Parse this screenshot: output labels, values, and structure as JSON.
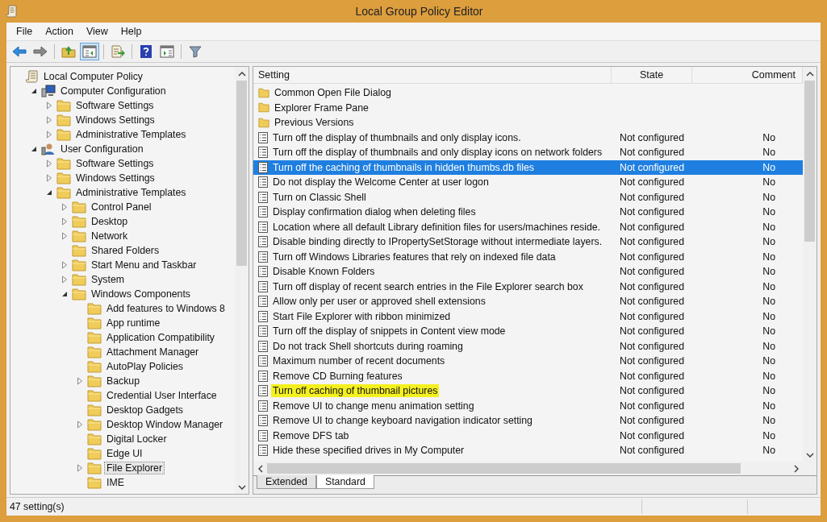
{
  "window": {
    "title": "Local Group Policy Editor"
  },
  "menu": [
    "File",
    "Action",
    "View",
    "Help"
  ],
  "toolbar": [
    {
      "kind": "back",
      "pressed": false
    },
    {
      "kind": "forward",
      "pressed": false
    },
    {
      "kind": "up",
      "pressed": false
    },
    {
      "kind": "tree",
      "pressed": true
    },
    {
      "kind": "export",
      "pressed": false
    },
    {
      "kind": "help",
      "pressed": false
    },
    {
      "kind": "pane",
      "pressed": false
    },
    {
      "kind": "filter",
      "pressed": false
    }
  ],
  "tree": [
    {
      "label": "Local Computer Policy",
      "kind": "policy",
      "selected": false,
      "children": [
        {
          "label": "Computer Configuration",
          "kind": "computer",
          "expanded": true,
          "selected": false,
          "children": [
            {
              "label": "Software Settings",
              "kind": "folder",
              "expanded": false,
              "selected": false
            },
            {
              "label": "Windows Settings",
              "kind": "folder",
              "expanded": false,
              "selected": false
            },
            {
              "label": "Administrative Templates",
              "kind": "folder",
              "expanded": false,
              "selected": false
            }
          ]
        },
        {
          "label": "User Configuration",
          "kind": "user",
          "expanded": true,
          "selected": false,
          "children": [
            {
              "label": "Software Settings",
              "kind": "folder",
              "expanded": false,
              "selected": false
            },
            {
              "label": "Windows Settings",
              "kind": "folder",
              "expanded": false,
              "selected": false
            },
            {
              "label": "Administrative Templates",
              "kind": "folder",
              "expanded": true,
              "selected": false,
              "children": [
                {
                  "label": "Control Panel",
                  "kind": "folder",
                  "expanded": false,
                  "selected": false
                },
                {
                  "label": "Desktop",
                  "kind": "folder",
                  "expanded": false,
                  "selected": false
                },
                {
                  "label": "Network",
                  "kind": "folder",
                  "expanded": false,
                  "selected": false
                },
                {
                  "label": "Shared Folders",
                  "kind": "folder",
                  "selected": false
                },
                {
                  "label": "Start Menu and Taskbar",
                  "kind": "folder",
                  "expanded": false,
                  "selected": false
                },
                {
                  "label": "System",
                  "kind": "folder",
                  "expanded": false,
                  "selected": false
                },
                {
                  "label": "Windows Components",
                  "kind": "folder",
                  "expanded": true,
                  "selected": false,
                  "children": [
                    {
                      "label": "Add features to Windows 8",
                      "kind": "folder",
                      "selected": false
                    },
                    {
                      "label": "App runtime",
                      "kind": "folder",
                      "selected": false
                    },
                    {
                      "label": "Application Compatibility",
                      "kind": "folder",
                      "selected": false
                    },
                    {
                      "label": "Attachment Manager",
                      "kind": "folder",
                      "selected": false
                    },
                    {
                      "label": "AutoPlay Policies",
                      "kind": "folder",
                      "selected": false
                    },
                    {
                      "label": "Backup",
                      "kind": "folder",
                      "expanded": false,
                      "selected": false
                    },
                    {
                      "label": "Credential User Interface",
                      "kind": "folder",
                      "selected": false
                    },
                    {
                      "label": "Desktop Gadgets",
                      "kind": "folder",
                      "selected": false
                    },
                    {
                      "label": "Desktop Window Manager",
                      "kind": "folder",
                      "expanded": false,
                      "selected": false
                    },
                    {
                      "label": "Digital Locker",
                      "kind": "folder",
                      "selected": false
                    },
                    {
                      "label": "Edge UI",
                      "kind": "folder",
                      "selected": false
                    },
                    {
                      "label": "File Explorer",
                      "kind": "folder",
                      "expanded": false,
                      "selected": true
                    },
                    {
                      "label": "IME",
                      "kind": "folder",
                      "selected": false
                    }
                  ]
                }
              ]
            }
          ]
        }
      ]
    }
  ],
  "table": {
    "columns": [
      "Setting",
      "State",
      "Comment"
    ],
    "rows": [
      {
        "kind": "folder",
        "setting": "Common Open File Dialog",
        "selected": false,
        "highlighted": false
      },
      {
        "kind": "folder",
        "setting": "Explorer Frame Pane",
        "selected": false,
        "highlighted": false
      },
      {
        "kind": "folder",
        "setting": "Previous Versions",
        "selected": false,
        "highlighted": false
      },
      {
        "kind": "setting",
        "setting": "Turn off the display of thumbnails and only display icons.",
        "state": "Not configured",
        "comment": "No",
        "selected": false,
        "highlighted": false
      },
      {
        "kind": "setting",
        "setting": "Turn off the display of thumbnails and only display icons on network folders",
        "state": "Not configured",
        "comment": "No",
        "selected": false,
        "highlighted": false
      },
      {
        "kind": "setting",
        "setting": "Turn off the caching of thumbnails in hidden thumbs.db files",
        "state": "Not configured",
        "comment": "No",
        "selected": true,
        "highlighted": false
      },
      {
        "kind": "setting",
        "setting": "Do not display the Welcome Center at user logon",
        "state": "Not configured",
        "comment": "No",
        "selected": false,
        "highlighted": false
      },
      {
        "kind": "setting",
        "setting": "Turn on Classic Shell",
        "state": "Not configured",
        "comment": "No",
        "selected": false,
        "highlighted": false
      },
      {
        "kind": "setting",
        "setting": "Display confirmation dialog when deleting files",
        "state": "Not configured",
        "comment": "No",
        "selected": false,
        "highlighted": false
      },
      {
        "kind": "setting",
        "setting": "Location where all default Library definition files for users/machines reside.",
        "state": "Not configured",
        "comment": "No",
        "selected": false,
        "highlighted": false
      },
      {
        "kind": "setting",
        "setting": "Disable binding directly to IPropertySetStorage without intermediate layers.",
        "state": "Not configured",
        "comment": "No",
        "selected": false,
        "highlighted": false
      },
      {
        "kind": "setting",
        "setting": "Turn off Windows Libraries features that rely on indexed file data",
        "state": "Not configured",
        "comment": "No",
        "selected": false,
        "highlighted": false
      },
      {
        "kind": "setting",
        "setting": "Disable Known Folders",
        "state": "Not configured",
        "comment": "No",
        "selected": false,
        "highlighted": false
      },
      {
        "kind": "setting",
        "setting": "Turn off display of recent search entries in the File Explorer search box",
        "state": "Not configured",
        "comment": "No",
        "selected": false,
        "highlighted": false
      },
      {
        "kind": "setting",
        "setting": "Allow only per user or approved shell extensions",
        "state": "Not configured",
        "comment": "No",
        "selected": false,
        "highlighted": false
      },
      {
        "kind": "setting",
        "setting": "Start File Explorer with ribbon minimized",
        "state": "Not configured",
        "comment": "No",
        "selected": false,
        "highlighted": false
      },
      {
        "kind": "setting",
        "setting": "Turn off the display of snippets in Content view mode",
        "state": "Not configured",
        "comment": "No",
        "selected": false,
        "highlighted": false
      },
      {
        "kind": "setting",
        "setting": "Do not track Shell shortcuts during roaming",
        "state": "Not configured",
        "comment": "No",
        "selected": false,
        "highlighted": false
      },
      {
        "kind": "setting",
        "setting": "Maximum number of recent documents",
        "state": "Not configured",
        "comment": "No",
        "selected": false,
        "highlighted": false
      },
      {
        "kind": "setting",
        "setting": "Remove CD Burning features",
        "state": "Not configured",
        "comment": "No",
        "selected": false,
        "highlighted": false
      },
      {
        "kind": "setting",
        "setting": "Turn off caching of thumbnail pictures",
        "state": "Not configured",
        "comment": "No",
        "selected": false,
        "highlighted": true
      },
      {
        "kind": "setting",
        "setting": "Remove UI to change menu animation setting",
        "state": "Not configured",
        "comment": "No",
        "selected": false,
        "highlighted": false
      },
      {
        "kind": "setting",
        "setting": "Remove UI to change keyboard navigation indicator setting",
        "state": "Not configured",
        "comment": "No",
        "selected": false,
        "highlighted": false
      },
      {
        "kind": "setting",
        "setting": "Remove DFS tab",
        "state": "Not configured",
        "comment": "No",
        "selected": false,
        "highlighted": false
      },
      {
        "kind": "setting",
        "setting": "Hide these specified drives in My Computer",
        "state": "Not configured",
        "comment": "No",
        "selected": false,
        "highlighted": false
      }
    ]
  },
  "view_tabs": [
    {
      "label": "Extended",
      "selected": false
    },
    {
      "label": "Standard",
      "selected": true
    }
  ],
  "status_bar": "47 setting(s)"
}
